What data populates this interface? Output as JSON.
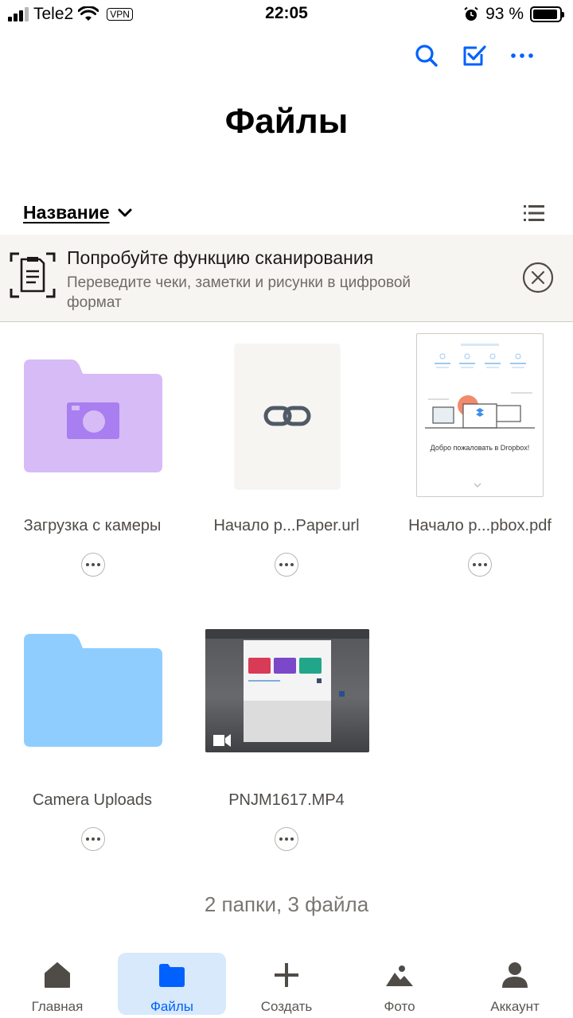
{
  "status_bar": {
    "carrier": "Tele2",
    "vpn": "VPN",
    "time": "22:05",
    "battery": "93 %",
    "battery_level": 0.93
  },
  "header": {
    "title": "Файлы",
    "icons": [
      "search-icon",
      "select-checkbox-icon",
      "more-horizontal-icon"
    ]
  },
  "sort": {
    "label": "Название"
  },
  "banner": {
    "title": "Попробуйте функцию сканирования",
    "subtitle": "Переведите чеки, заметки и рисунки в цифровой формат"
  },
  "items": [
    {
      "name": "Загрузка с камеры",
      "type": "camera-folder"
    },
    {
      "name": "Начало р...Paper.url",
      "type": "link-file"
    },
    {
      "name": "Начало р...pbox.pdf",
      "type": "pdf-file",
      "preview_text": "Добро пожаловать в Dropbox!"
    },
    {
      "name": "Camera Uploads",
      "type": "folder"
    },
    {
      "name": "PNJM1617.MP4",
      "type": "video-file"
    }
  ],
  "summary": "2 папки, 3 файла",
  "tabs": [
    {
      "label": "Главная",
      "icon": "home-icon"
    },
    {
      "label": "Файлы",
      "icon": "folder-icon",
      "active": true
    },
    {
      "label": "Создать",
      "icon": "plus-icon"
    },
    {
      "label": "Фото",
      "icon": "photo-icon"
    },
    {
      "label": "Аккаунт",
      "icon": "account-icon"
    }
  ],
  "colors": {
    "accent": "#0061fe",
    "camera_folder": "#d6bbf6",
    "folder": "#90cdff",
    "active_tab_bg": "#d7e9fb"
  }
}
